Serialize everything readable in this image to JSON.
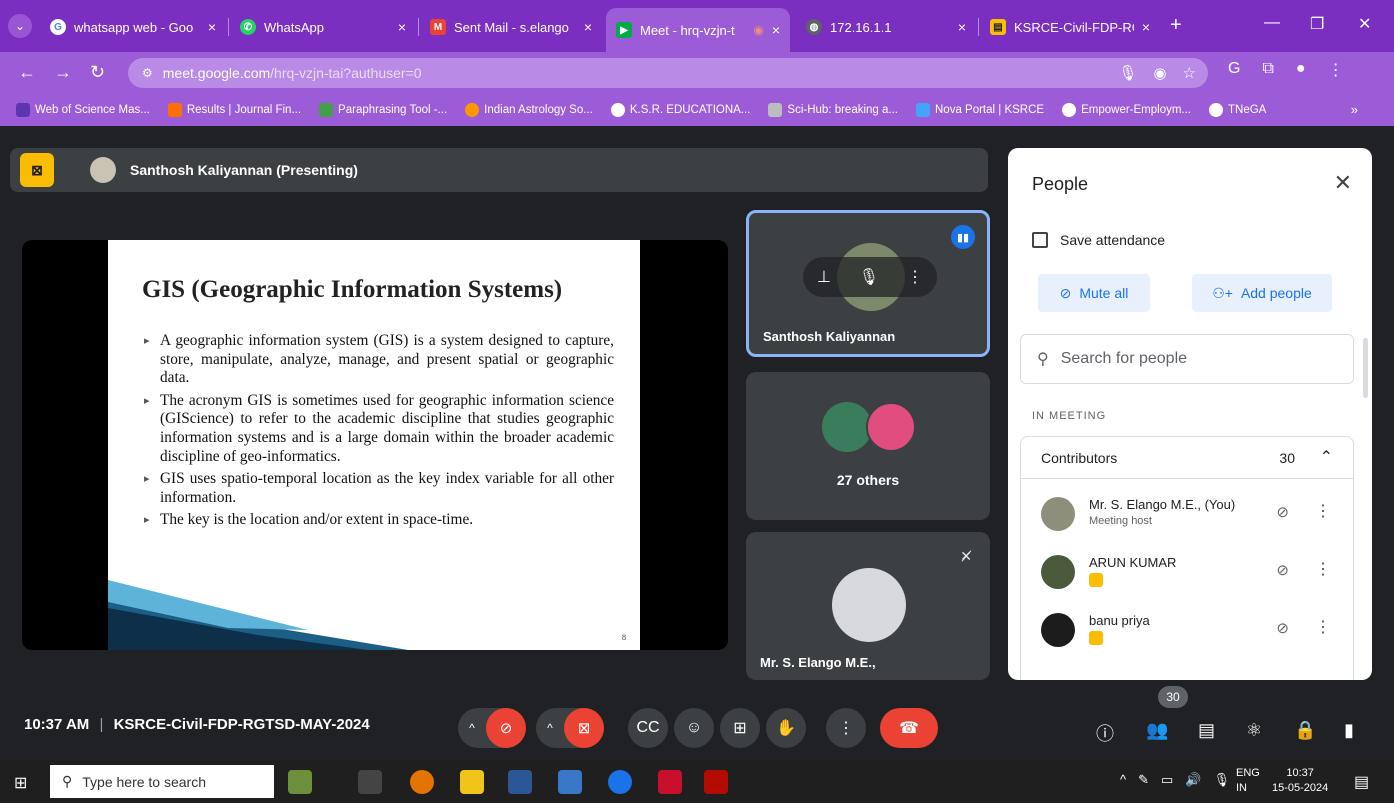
{
  "browser": {
    "tabs": [
      {
        "label": "whatsapp web - Goo",
        "fav_color": "#ffffff"
      },
      {
        "label": "WhatsApp",
        "fav_color": "#25d366"
      },
      {
        "label": "Sent Mail - s.elango",
        "fav_color": "#ea4335"
      },
      {
        "label": "Meet - hrq-vzjn-t",
        "fav_color": "#00ac47"
      },
      {
        "label": "172.16.1.1",
        "fav_color": "#5f6368"
      },
      {
        "label": "KSRCE-Civil-FDP-RGT",
        "fav_color": "#fbbc04"
      }
    ],
    "close_glyph": "×",
    "new_tab": "+",
    "url_host": "meet.google.com",
    "url_path": "/hrq-vzjn-tai?authuser=0",
    "bookmarks": [
      {
        "label": "Web of Science Mas...",
        "color": "#5e35b1"
      },
      {
        "label": "Results | Journal Fin...",
        "color": "#ff6f00"
      },
      {
        "label": "Paraphrasing Tool -...",
        "color": "#43a047"
      },
      {
        "label": "Indian Astrology So...",
        "color": "#ff9800"
      },
      {
        "label": "K.S.R. EDUCATIONA...",
        "color": "#ffffff"
      },
      {
        "label": "Sci-Hub: breaking a...",
        "color": "#bdbdbd"
      },
      {
        "label": "Nova Portal | KSRCE",
        "color": "#42a5f5"
      },
      {
        "label": "Empower-Employm...",
        "color": "#ffffff"
      },
      {
        "label": "TNeGA",
        "color": "#ffffff"
      }
    ],
    "bookmarks_more": "»"
  },
  "meet": {
    "presenter_label": "Santhosh Kaliyannan (Presenting)",
    "slide": {
      "title": "GIS (Geographic Information Systems)",
      "bullets": [
        "A geographic information system (GIS) is a system designed to capture, store, manipulate, analyze, manage, and present spatial or geographic data.",
        "The acronym GIS is sometimes used for geographic information science (GIScience) to refer to the academic discipline that studies geographic information systems and is a large domain within the broader academic discipline of geo-informatics.",
        "GIS uses spatio-temporal location as the key index variable for all other information.",
        "The key is the location and/or extent in space-time."
      ],
      "page_mark": "8"
    },
    "tiles": [
      {
        "name": "Santhosh Kaliyannan"
      },
      {
        "name": "27 others"
      },
      {
        "name": "Mr. S. Elango M.E.,"
      }
    ],
    "people_panel": {
      "title": "People",
      "save_attendance": "Save attendance",
      "mute_all": "Mute all",
      "add_people": "Add people",
      "search_placeholder": "Search for people",
      "section": "IN MEETING",
      "group_label": "Contributors",
      "group_count": "30",
      "participants": [
        {
          "name": "Mr. S. Elango M.E., (You)",
          "sub": "Meeting host",
          "avatar_color": "#8d8f7a"
        },
        {
          "name": "ARUN KUMAR",
          "sub": "",
          "avatar_color": "#4a5a3a"
        },
        {
          "name": "banu priya",
          "sub": "",
          "avatar_color": "#1c1c1c"
        }
      ]
    },
    "bottom": {
      "time": "10:37 AM",
      "meeting_name": "KSRCE-Civil-FDP-RGTSD-MAY-2024",
      "separator": "|",
      "people_count": "30"
    }
  },
  "taskbar": {
    "search_placeholder": "Type here to search",
    "lang_top": "ENG",
    "lang_bottom": "IN",
    "clock_time": "10:37",
    "clock_date": "15-05-2024"
  },
  "colors": {
    "accent_purple": "#7a2fc0",
    "meet_red": "#ea4335",
    "meet_blue": "#1a73e8",
    "present_yellow": "#fbbc04"
  }
}
